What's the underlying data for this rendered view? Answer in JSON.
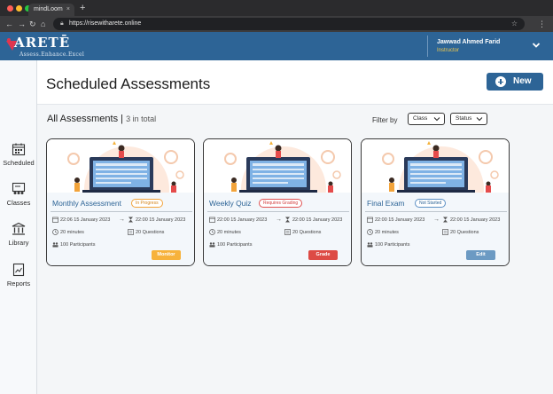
{
  "browser": {
    "tab_title": "mindLoom",
    "tab_close": "×",
    "new_tab": "+",
    "url": "https://risewitharete.online"
  },
  "header": {
    "logo_text": "ARETĒ",
    "logo_tagline": "Assess.Enhance.Excel",
    "user_name": "Jawwad Ahmed Farid",
    "user_role": "Instructor"
  },
  "sidebar": {
    "items": [
      {
        "label": "Scheduled",
        "icon": "calendar-icon"
      },
      {
        "label": "Classes",
        "icon": "classroom-icon"
      },
      {
        "label": "Library",
        "icon": "library-icon"
      },
      {
        "label": "Reports",
        "icon": "report-icon"
      }
    ]
  },
  "main": {
    "title": "Scheduled Assessments",
    "new_button": "New",
    "section_title": "All Assessments",
    "section_sep": " | ",
    "section_count": "3 in total",
    "filter_label": "Filter by",
    "filters": {
      "class": "Class",
      "status": "Status"
    }
  },
  "cards": [
    {
      "title": "Monthly Assessment",
      "status": "In Progress",
      "start": "22:06 15 January 2023",
      "end": "22:00 15 January 2023",
      "duration": "20 minutes",
      "questions": "20 Questions",
      "participants": "100 Participants",
      "action": "Monitor"
    },
    {
      "title": "Weekly Quiz",
      "status": "Requires Grading",
      "start": "22:00 15 January 2023",
      "end": "22:00 15 January 2023",
      "duration": "20 minutes",
      "questions": "20 Questions",
      "participants": "100 Participants",
      "action": "Grade"
    },
    {
      "title": "Final Exam",
      "status": "Not Started",
      "start": "22:00 15 January 2023",
      "end": "22:00 15 January 2023",
      "duration": "20 minutes",
      "questions": "20 Questions",
      "participants": "100 Participants",
      "action": "Edit"
    }
  ],
  "colors": {
    "brand": "#2d6496",
    "monitor": "#f7b23b",
    "grade": "#dd4b45",
    "edit": "#6c9ac3"
  }
}
